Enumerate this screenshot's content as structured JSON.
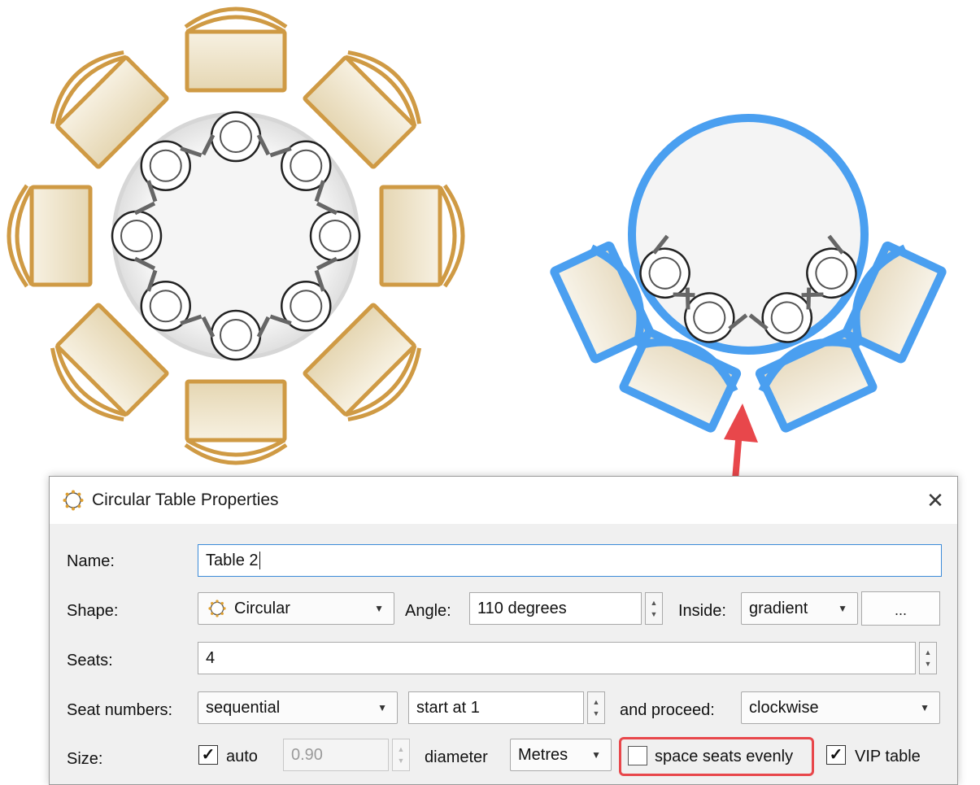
{
  "dialog": {
    "title": "Circular Table Properties",
    "close_icon": "close-icon",
    "name": {
      "label": "Name:",
      "value": "Table 2"
    },
    "shape": {
      "label": "Shape:",
      "value": "Circular",
      "angle_label": "Angle:",
      "angle_value": "110 degrees",
      "inside_label": "Inside:",
      "inside_value": "gradient",
      "more_button": "..."
    },
    "seats": {
      "label": "Seats:",
      "value": "4"
    },
    "seat_numbers": {
      "label": "Seat numbers:",
      "value": "sequential",
      "start_value": "start at 1",
      "proceed_label": "and proceed:",
      "proceed_value": "clockwise"
    },
    "size": {
      "label": "Size:",
      "auto_label": "auto",
      "auto_checked": true,
      "size_value": "0.90",
      "diameter_label": "diameter",
      "unit_value": "Metres",
      "space_label": "space seats evenly",
      "space_checked": false,
      "vip_label": "VIP table",
      "vip_checked": true
    }
  },
  "colors": {
    "chair_orange": "#cf9a44",
    "chair_fill": "#efe5cc",
    "selection_blue": "#4a9ff0",
    "table_grey": "#e6e6e6",
    "arrow_red": "#e8474b"
  }
}
